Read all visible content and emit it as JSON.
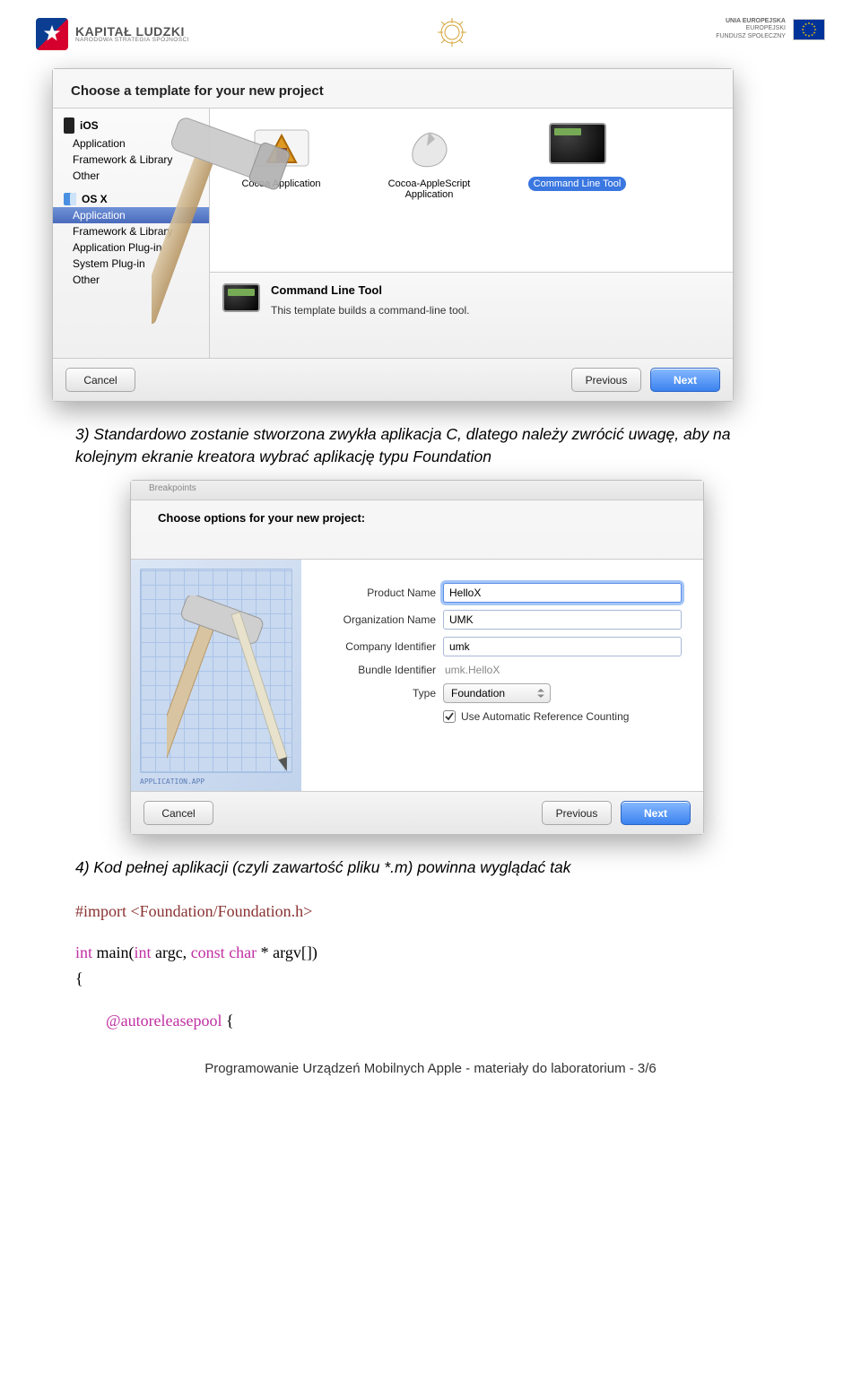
{
  "header": {
    "kl_top": "KAPITAŁ LUDZKI",
    "kl_sub": "NARODOWA STRATEGIA SPÓJNOŚCI",
    "eu_line1": "UNIA EUROPEJSKA",
    "eu_line2": "EUROPEJSKI",
    "eu_line3": "FUNDUSZ SPOŁECZNY"
  },
  "dialog1": {
    "title": "Choose a template for your new project",
    "sidebar": {
      "ios_header": "iOS",
      "ios_items": [
        "Application",
        "Framework & Library",
        "Other"
      ],
      "osx_header": "OS X",
      "osx_items": [
        "Application",
        "Framework & Library",
        "Application Plug-in",
        "System Plug-in",
        "Other"
      ],
      "osx_selected_index": 0
    },
    "templates": [
      {
        "label": "Cocoa Application",
        "selected": false
      },
      {
        "label": "Cocoa-AppleScript Application",
        "selected": false
      },
      {
        "label": "Command Line Tool",
        "selected": true
      }
    ],
    "desc": {
      "title": "Command Line Tool",
      "text": "This template builds a command-line tool."
    },
    "buttons": {
      "cancel": "Cancel",
      "previous": "Previous",
      "next": "Next"
    }
  },
  "para1": "3) Standardowo zostanie stworzona zwykła aplikacja C, dlatego należy zwrócić uwagę, aby na kolejnym ekranie kreatora wybrać aplikację typu Foundation",
  "dialog2": {
    "tab": "Breakpoints",
    "title": "Choose options for your new project:",
    "fields": {
      "product_name_label": "Product Name",
      "product_name_value": "HelloX",
      "org_label": "Organization Name",
      "org_value": "UMK",
      "company_label": "Company Identifier",
      "company_value": "umk",
      "bundle_label": "Bundle Identifier",
      "bundle_value": "umk.HelloX",
      "type_label": "Type",
      "type_value": "Foundation",
      "arc_label": "Use Automatic Reference Counting",
      "arc_checked": true
    },
    "buttons": {
      "cancel": "Cancel",
      "previous": "Previous",
      "next": "Next"
    }
  },
  "para2": "4) Kod pełnej aplikacji (czyli zawartość pliku *.m) powinna wyglądać tak",
  "code": {
    "import_kw": "#import",
    "import_target": "<Foundation/Foundation.h>",
    "int": "int",
    "main_sig": " main(",
    "int2": "int",
    "main_sig2": " argc, ",
    "const": "const",
    "main_sig3": " char",
    "main_sig4": " * argv[])",
    "brace": "{",
    "autorelease": "@autoreleasepool",
    "brace2": " {"
  },
  "footer": "Programowanie Urządzeń Mobilnych Apple  - materiały do laboratorium - 3/6"
}
